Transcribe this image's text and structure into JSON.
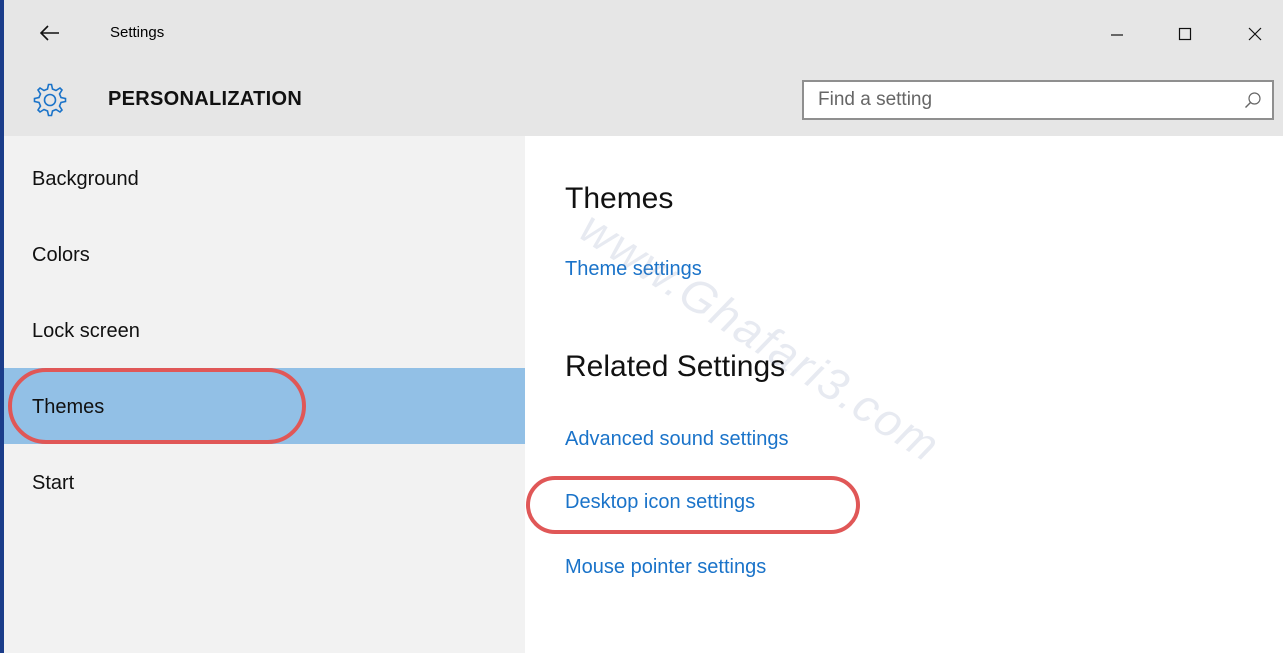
{
  "window": {
    "title": "Settings",
    "controls": {
      "minimize": "minimize",
      "maximize": "maximize",
      "close": "close"
    }
  },
  "header": {
    "section_title": "PERSONALIZATION",
    "search_placeholder": "Find a setting"
  },
  "sidebar": {
    "items": [
      {
        "label": "Background",
        "active": false
      },
      {
        "label": "Colors",
        "active": false
      },
      {
        "label": "Lock screen",
        "active": false
      },
      {
        "label": "Themes",
        "active": true
      },
      {
        "label": "Start",
        "active": false
      }
    ]
  },
  "main": {
    "themes_heading": "Themes",
    "theme_settings_link": "Theme settings",
    "related_heading": "Related Settings",
    "related_links": [
      "Advanced sound settings",
      "Desktop icon settings",
      "Mouse pointer settings"
    ]
  },
  "watermark": "www.Ghafari3.com",
  "colors": {
    "accent_link": "#1a73c9",
    "selection": "#92c0e6",
    "highlight_oval": "#e05757"
  }
}
